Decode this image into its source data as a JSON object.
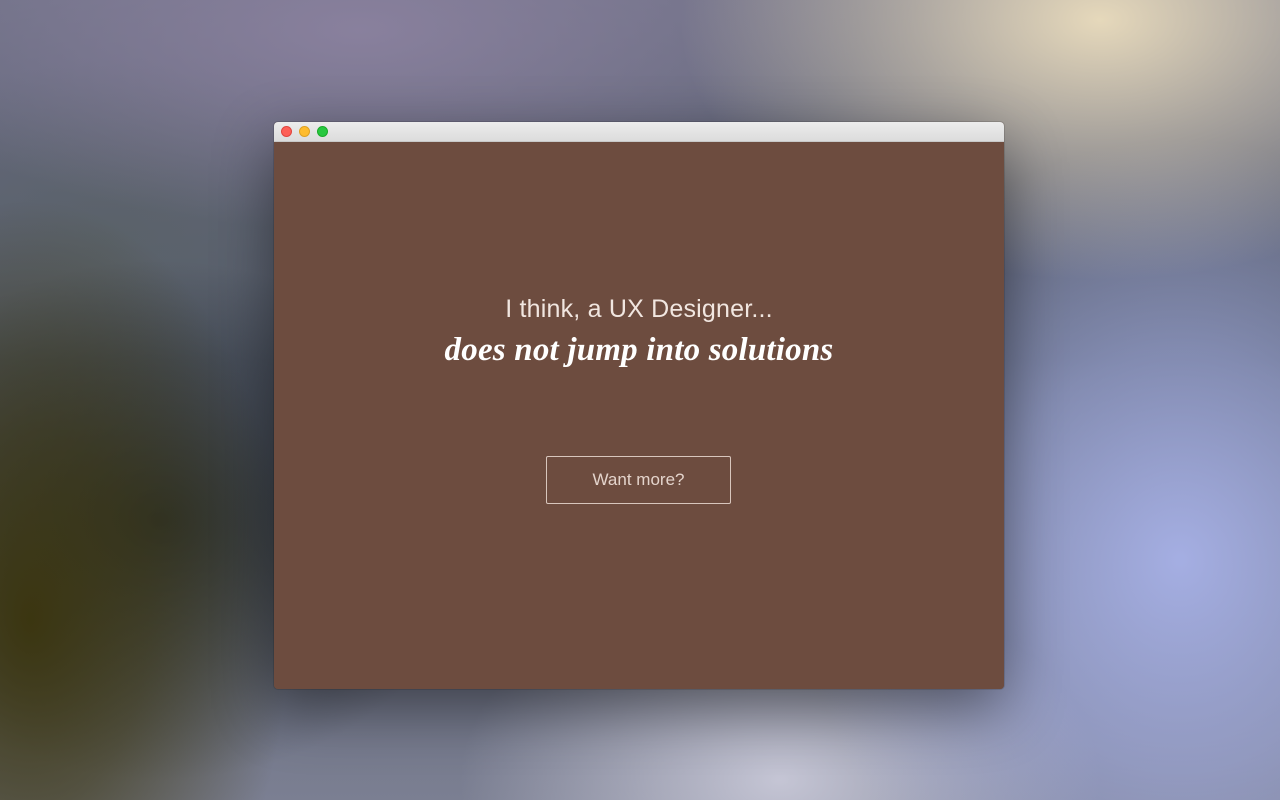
{
  "window": {
    "controls": {
      "close_icon": "close-icon",
      "minimize_icon": "minimize-icon",
      "zoom_icon": "zoom-icon"
    },
    "background_color": "#6d4c3f"
  },
  "main": {
    "intro": "I think, a UX Designer...",
    "headline": "does not jump into solutions",
    "cta_label": "Want more?"
  }
}
